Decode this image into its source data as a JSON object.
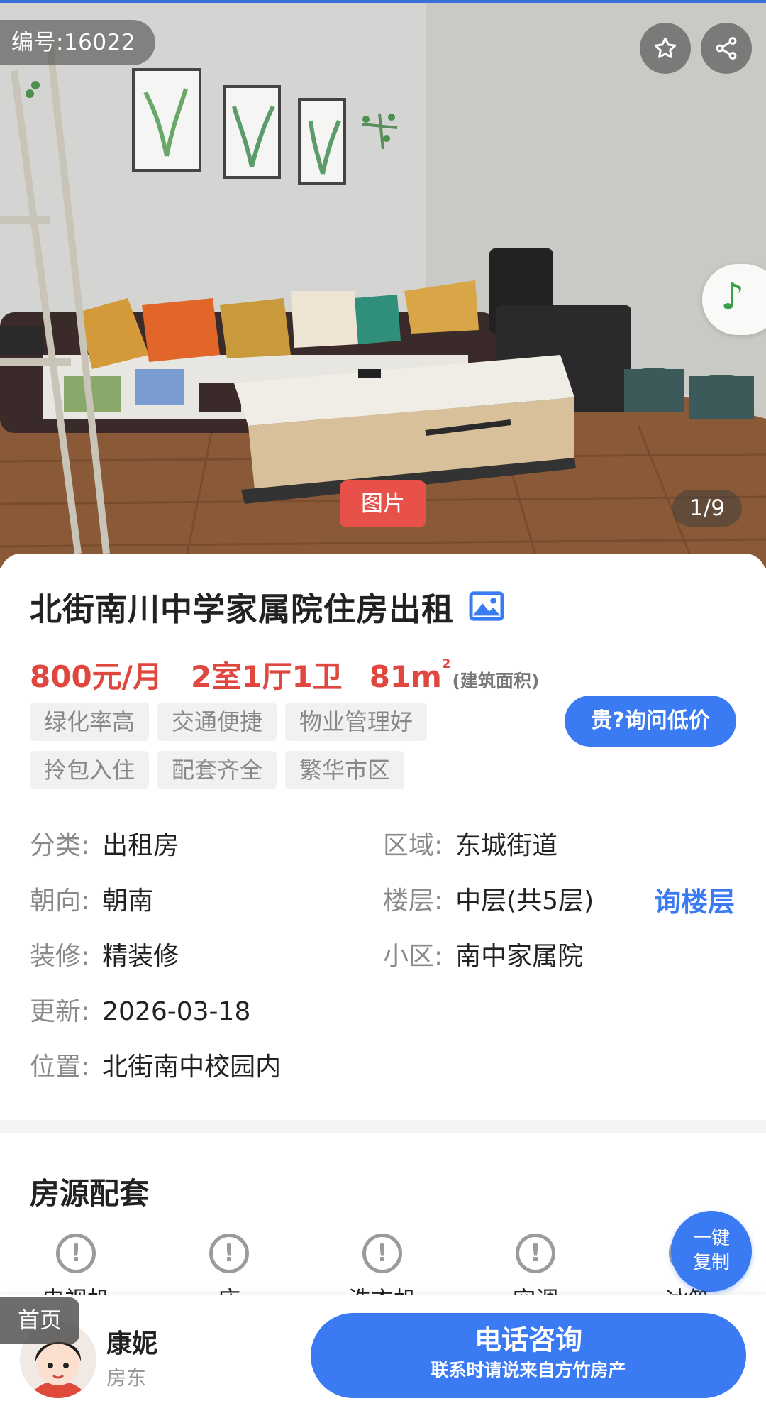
{
  "hero": {
    "listing_id": "编号:16022",
    "photo_tag": "图片",
    "photo_counter": "1/9",
    "icons": [
      "star-icon",
      "share-icon",
      "music-note-icon"
    ]
  },
  "listing": {
    "title": "北街南川中学家属院住房出租",
    "price": "800元/月",
    "layout": "2室1厅1卫",
    "area_value": "81m",
    "area_unit_sup": "2",
    "area_note": "(建筑面积)",
    "tags": [
      "绿化率高",
      "交通便捷",
      "物业管理好",
      "拎包入住",
      "配套齐全",
      "繁华市区"
    ],
    "ask_price_button": "贵?询问低价",
    "ask_floor_link": "询楼层",
    "attributes": [
      {
        "key": "分类:",
        "value": "出租房"
      },
      {
        "key": "区域:",
        "value": "东城街道"
      },
      {
        "key": "朝向:",
        "value": "朝南"
      },
      {
        "key": "楼层:",
        "value": "中层(共5层)"
      },
      {
        "key": "装修:",
        "value": "精装修"
      },
      {
        "key": "小区:",
        "value": "南中家属院"
      },
      {
        "key": "更新:",
        "value": "2026-03-18"
      },
      {
        "key": "位置:",
        "value": "北街南中校园内"
      }
    ]
  },
  "facilities": {
    "section_title": "房源配套",
    "items": [
      "电视机",
      "床",
      "洗衣机",
      "空调",
      "冰箱"
    ],
    "status_icon": "exclamation-circle-icon",
    "copy_button_line1": "一键",
    "copy_button_line2": "复制"
  },
  "bottom_bar": {
    "home_label": "首页",
    "agent_name": "康妮",
    "agent_role": "房东",
    "call_main": "电话咨询",
    "call_sub": "联系时请说来自方竹房产"
  },
  "colors": {
    "accent_blue": "#3a7af3",
    "price_red": "#e0473f",
    "photo_tag_red": "#e8504a"
  }
}
